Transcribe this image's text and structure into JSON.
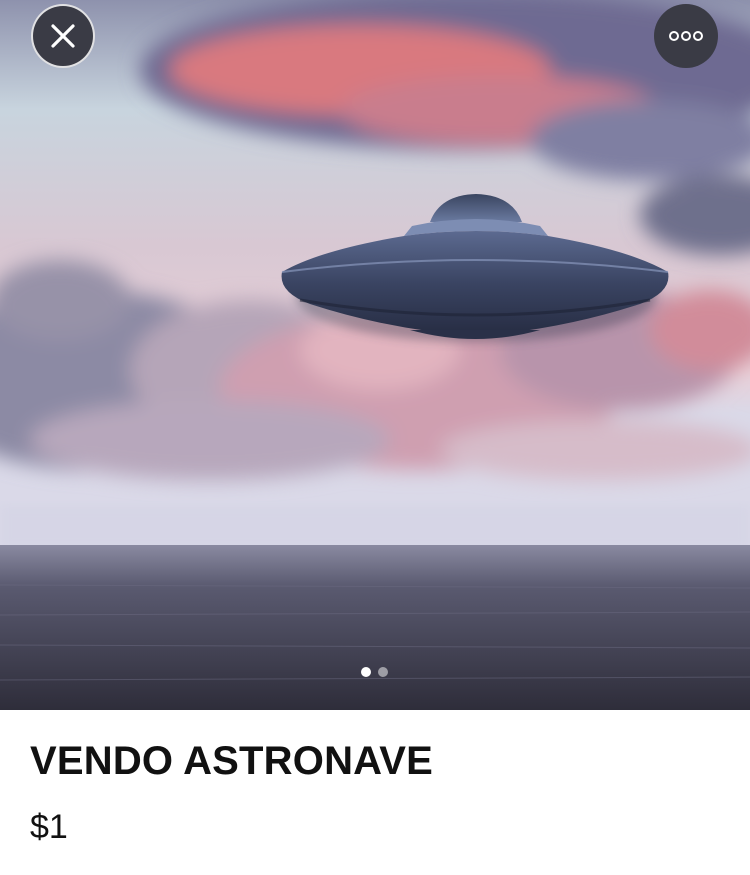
{
  "listing": {
    "title": "VENDO ASTRONAVE",
    "price": "$1"
  },
  "gallery": {
    "photo_count": 2,
    "current_photo": 1
  },
  "icons": {
    "close": "close-icon",
    "more": "more-horizontal-icon"
  },
  "colors": {
    "button_bg": "#3a3b45",
    "text": "#111111",
    "background": "#ffffff"
  }
}
